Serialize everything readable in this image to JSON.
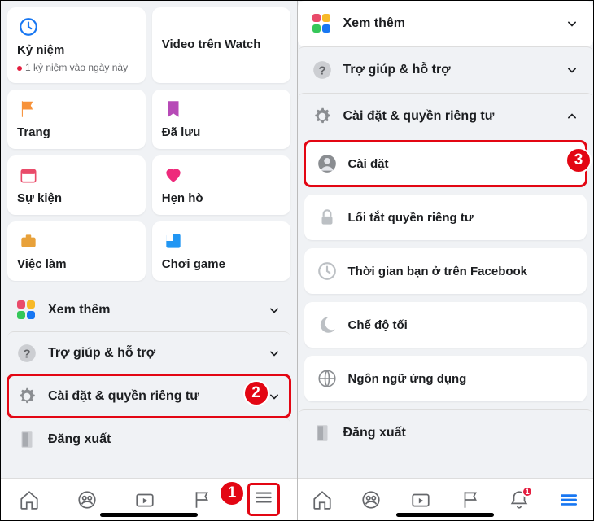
{
  "left": {
    "cards": {
      "memories": {
        "label": "Kỷ niệm",
        "sub": "1 kỷ niệm vào ngày này"
      },
      "watch": {
        "label": "Video trên Watch"
      },
      "pages": {
        "label": "Trang"
      },
      "saved": {
        "label": "Đã lưu"
      },
      "events": {
        "label": "Sự kiện"
      },
      "dating": {
        "label": "Hẹn hò"
      },
      "jobs": {
        "label": "Việc làm"
      },
      "gaming": {
        "label": "Chơi game"
      }
    },
    "see_more": "Xem thêm",
    "help": "Trợ giúp & hỗ trợ",
    "settings": "Cài đặt & quyền riêng tư",
    "logout": "Đăng xuất"
  },
  "right": {
    "see_more": "Xem thêm",
    "help": "Trợ giúp & hỗ trợ",
    "settings": "Cài đặt & quyền riêng tư",
    "items": {
      "settings": "Cài đặt",
      "privacy": "Lối tắt quyền riêng tư",
      "time": "Thời gian bạn ở trên Facebook",
      "dark": "Chế độ tối",
      "lang": "Ngôn ngữ ứng dụng"
    },
    "logout": "Đăng xuất",
    "noti_count": "1"
  },
  "step": {
    "one": "1",
    "two": "2",
    "three": "3"
  }
}
